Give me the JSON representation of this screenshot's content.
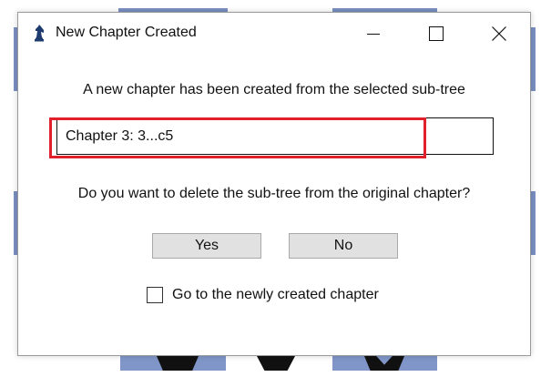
{
  "dialog": {
    "title": "New Chapter Created",
    "message": "A new chapter has been created from the selected sub-tree",
    "chapter_name_value": "Chapter 3: 3...c5",
    "question": "Do you want to delete the sub-tree from the original chapter?",
    "yes_label": "Yes",
    "no_label": "No",
    "goto_label": "Go to the newly created chapter",
    "goto_checked": false
  },
  "window_controls": {
    "minimize_icon": "minimize-icon",
    "maximize_icon": "maximize-icon",
    "close_icon": "close-icon"
  },
  "colors": {
    "highlight": "#e0202a",
    "button_bg": "#e1e1e1",
    "board_square": "#8096c8"
  }
}
